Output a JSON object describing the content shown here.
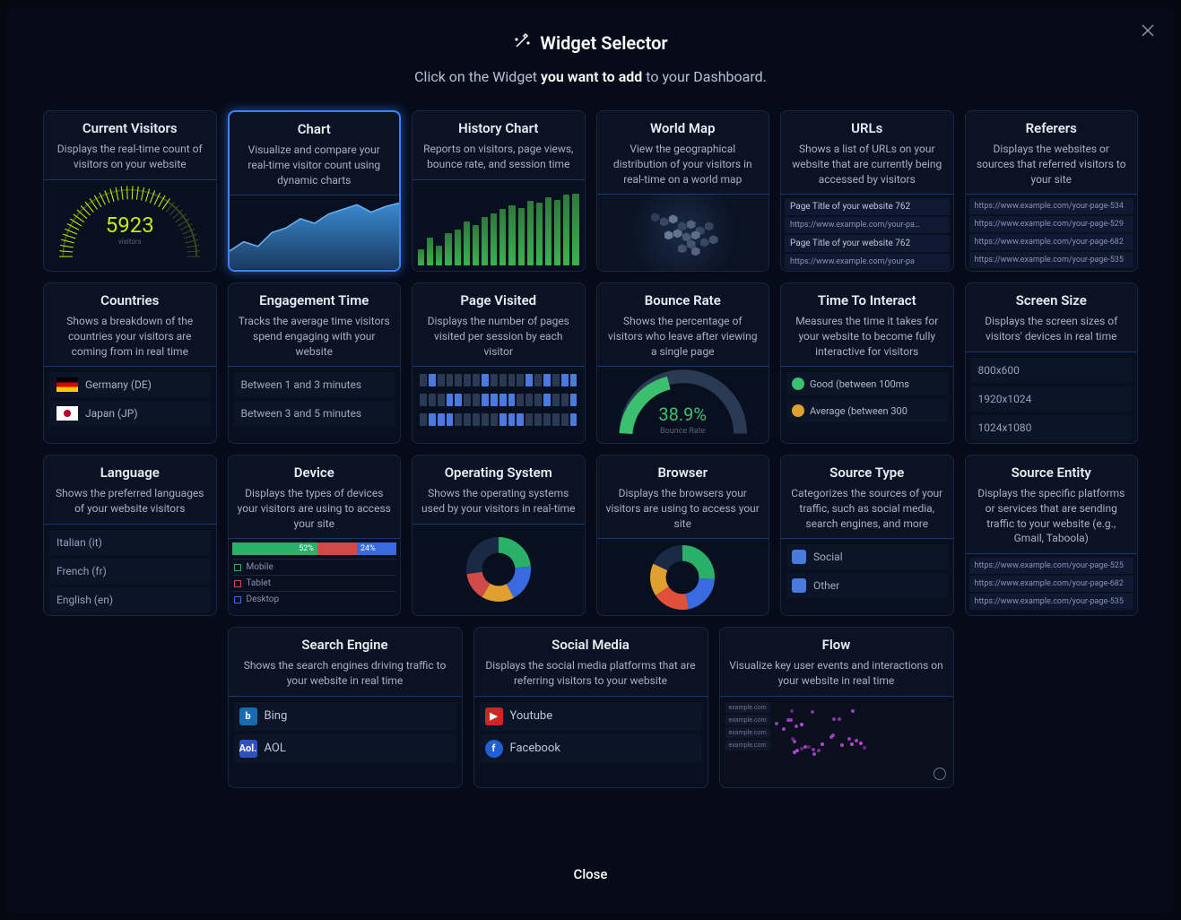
{
  "header": {
    "title": "Widget Selector",
    "subtitle_before": "Click on the Widget ",
    "subtitle_bold": "you want to add",
    "subtitle_after": " to your Dashboard."
  },
  "closeLabel": "Close",
  "cards": {
    "visitors": {
      "title": "Current Visitors",
      "desc": "Displays the real-time count of visitors on your website",
      "value": "5923",
      "unit": "visitors"
    },
    "chart": {
      "title": "Chart",
      "desc": "Visualize and compare your real-time visitor count using dynamic charts"
    },
    "history": {
      "title": "History Chart",
      "desc": "Reports on visitors, page views, bounce rate, and session time"
    },
    "worldmap": {
      "title": "World Map",
      "desc": "View the geographical distribution of your visitors in real-time on a world map"
    },
    "urls": {
      "title": "URLs",
      "desc": "Shows a list of URLs on your website that are currently being accessed by visitors",
      "items": [
        "Page Title of your website 762",
        "https://www.example.com/your-pa…",
        "Page Title of your website 762",
        "https://www.example.com/your-pa"
      ]
    },
    "referers": {
      "title": "Referers",
      "desc": "Displays the websites or sources that referred visitors to your site",
      "items": [
        "https://www.example.com/your-page-534",
        "https://www.example.com/your-page-529",
        "https://www.example.com/your-page-682",
        "https://www.example.com/your-page-535"
      ]
    },
    "countries": {
      "title": "Countries",
      "desc": "Shows a breakdown of the countries your visitors are coming from in real time",
      "items": [
        {
          "flag": "de",
          "label": "Germany (DE)"
        },
        {
          "flag": "jp",
          "label": "Japan (JP)"
        }
      ]
    },
    "engagement": {
      "title": "Engagement Time",
      "desc": "Tracks the average time visitors spend engaging with your website",
      "items": [
        "Between 1 and 3 minutes",
        "Between 3 and 5 minutes"
      ]
    },
    "pagevisited": {
      "title": "Page Visited",
      "desc": "Displays the number of pages visited per session by each visitor"
    },
    "bounce": {
      "title": "Bounce Rate",
      "desc": "Shows the percentage of visitors who leave after viewing a single page",
      "pct": "38.9%",
      "label": "Bounce Rate"
    },
    "tti": {
      "title": "Time To Interact",
      "desc": "Measures the time it takes for your website to become fully interactive for visitors",
      "items": [
        {
          "color": "#3bc070",
          "label": "Good (between 100ms"
        },
        {
          "color": "#e0a030",
          "label": "Average (between 300"
        }
      ]
    },
    "screensize": {
      "title": "Screen Size",
      "desc": "Displays the screen sizes of visitors' devices in real time",
      "items": [
        "800x600",
        "1920x1024",
        "1024x1080"
      ]
    },
    "language": {
      "title": "Language",
      "desc": "Shows the preferred languages of your website visitors",
      "items": [
        "Italian (it)",
        "French (fr)",
        "English (en)"
      ]
    },
    "device": {
      "title": "Device",
      "desc": "Displays the types of devices your visitors are using to access your site",
      "pct1": "52%",
      "pct2": "24%",
      "items": [
        "Mobile",
        "Tablet",
        "Desktop"
      ]
    },
    "os": {
      "title": "Operating System",
      "desc": "Shows the operating systems used by your visitors in real-time"
    },
    "browser": {
      "title": "Browser",
      "desc": "Displays the browsers your visitors are using to access your site"
    },
    "sourcetype": {
      "title": "Source Type",
      "desc": "Categorizes the sources of your traffic, such as social media, search engines, and more",
      "items": [
        {
          "color": "#4a7ae0",
          "label": "Social"
        },
        {
          "color": "#4a7ae0",
          "label": "Other"
        }
      ]
    },
    "sourceentity": {
      "title": "Source Entity",
      "desc": "Displays the specific platforms or services that are sending traffic to your website (e.g., Gmail, Taboola)",
      "items": [
        "https://www.example.com/your-page-525",
        "https://www.example.com/your-page-682",
        "https://www.example.com/your-page-535"
      ]
    },
    "searchengine": {
      "title": "Search Engine",
      "desc": "Shows the search engines driving traffic to your website in real time",
      "items": [
        {
          "bg": "#1a6ab0",
          "txt": "b",
          "label": "Bing"
        },
        {
          "bg": "#3050c0",
          "txt": "Aol.",
          "label": "AOL"
        }
      ]
    },
    "socialmedia": {
      "title": "Social Media",
      "desc": "Displays the social media platforms that are referring visitors to your website",
      "items": [
        {
          "bg": "#d02525",
          "txt": "▶",
          "label": "Youtube"
        },
        {
          "bg": "#2060d0",
          "txt": "f",
          "label": "Facebook"
        }
      ]
    },
    "flow": {
      "title": "Flow",
      "desc": "Visualize key user events and interactions on your website in real time",
      "items": [
        "example.com",
        "example.com",
        "example.com",
        "example.com"
      ]
    }
  }
}
